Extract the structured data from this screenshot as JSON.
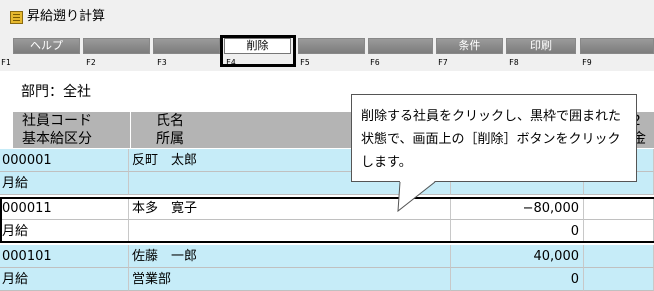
{
  "window": {
    "title": "昇給遡り計算",
    "icon": "calculator-icon"
  },
  "toolbar": {
    "buttons": [
      {
        "label": "ヘルプ",
        "key": "F1"
      },
      {
        "label": "",
        "key": "F2"
      },
      {
        "label": "",
        "key": "F3"
      },
      {
        "label": "削除",
        "key": "F4"
      },
      {
        "label": "",
        "key": "F5"
      },
      {
        "label": "",
        "key": "F6"
      },
      {
        "label": "条件",
        "key": "F7"
      },
      {
        "label": "印刷",
        "key": "F8"
      },
      {
        "label": "",
        "key": "F9"
      }
    ]
  },
  "department": "部門：全社",
  "list": {
    "headers": {
      "row1": [
        "社員コード",
        "氏名"
      ],
      "row2": [
        "基本給区分",
        "所属"
      ],
      "partial_right_1": "2年",
      "partial_right_2": "金額"
    },
    "employees": [
      {
        "code": "000001",
        "name": "反町　太郎",
        "pay_type": "月給",
        "dept": "",
        "amount": "",
        "amount2": ""
      },
      {
        "code": "000011",
        "name": "本多　寛子",
        "pay_type": "月給",
        "dept": "",
        "amount": "−80,000",
        "amount2": "0"
      },
      {
        "code": "000101",
        "name": "佐藤　一郎",
        "pay_type": "月給",
        "dept": "営業部",
        "amount": "40,000",
        "amount2": "0"
      }
    ],
    "selected_index": 1
  },
  "callout": {
    "text": "削除する社員をクリックし、黒枠で囲まれた状態で、画面上の［削除］ボタンをクリックします。"
  },
  "colors": {
    "row_highlight": "#c6ecf8",
    "header_gray": "#b4b4b4",
    "selection_frame": "#000000"
  }
}
